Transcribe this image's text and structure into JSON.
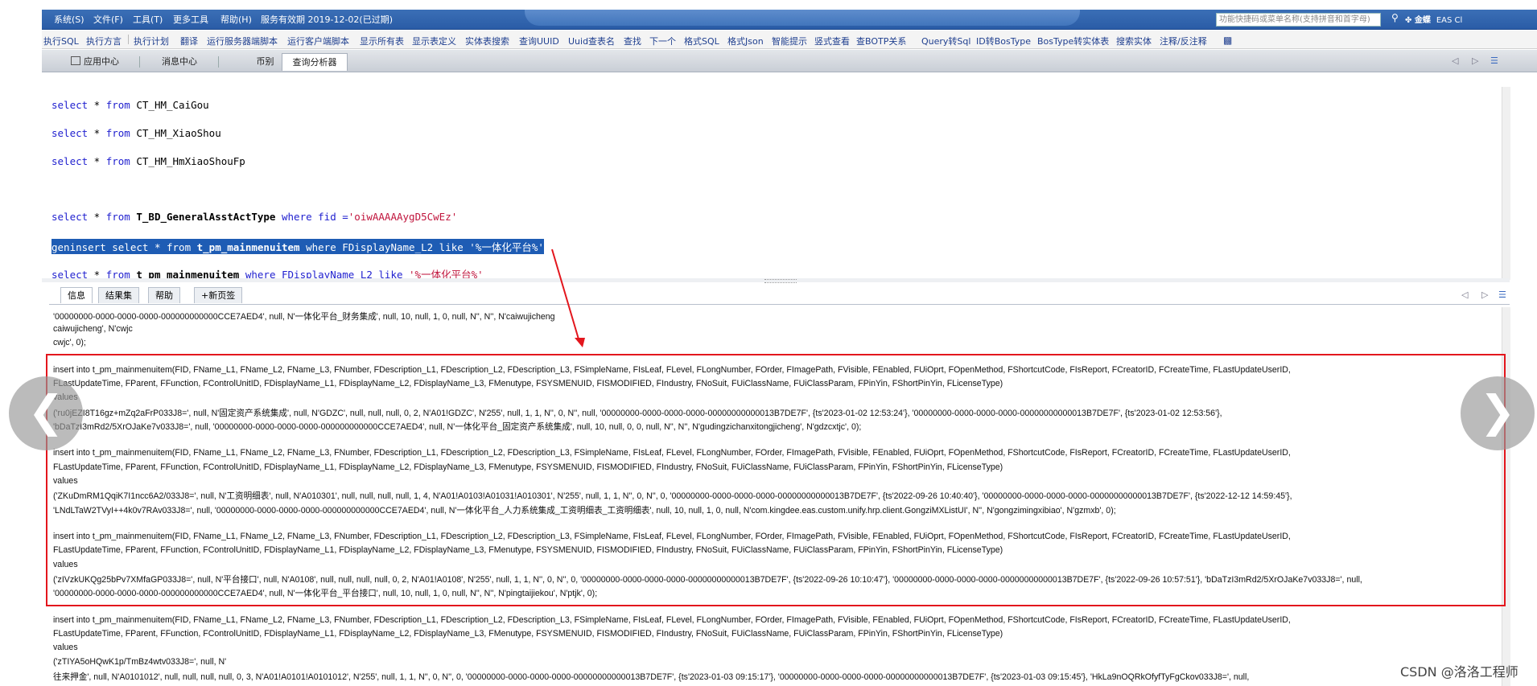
{
  "menubar": {
    "items": [
      "系统(S)",
      "文件(F)",
      "工具(T)",
      "更多工具",
      "帮助(H)",
      "服务有效期 2019-12-02(已过期)"
    ],
    "search_placeholder": "功能快捷码或菜单名称(支持拼音和首字母)",
    "brand": "金蝶",
    "brand_suffix": "EAS Cl"
  },
  "toolbar": {
    "items": [
      "执行SQL",
      "执行方言",
      "执行计划",
      "翻译",
      "运行服务器端脚本",
      "运行客户端脚本",
      "显示所有表",
      "显示表定义",
      "实体表搜索",
      "查询UUID",
      "Uuid查表名",
      "查找",
      "下一个",
      "格式SQL",
      "格式Json",
      "智能提示",
      "竖式查看",
      "查BOTP关系",
      "Query转Sql",
      "ID转BosType",
      "BosType转实体表",
      "搜索实体",
      "注释/反注释"
    ]
  },
  "nav_tabs": [
    "应用中心",
    "消息中心",
    "币别",
    "查询分析器"
  ],
  "editor": {
    "lines": [
      {
        "kw1": "select",
        "mid": " * ",
        "kw2": "from",
        "table": " CT_HM_CaiGou",
        "rest": "",
        "str": "",
        "bold": false,
        "selected": false
      },
      {
        "kw1": "select",
        "mid": " * ",
        "kw2": "from",
        "table": " CT_HM_XiaoShou",
        "rest": "",
        "str": "",
        "bold": false,
        "selected": false
      },
      {
        "kw1": "select",
        "mid": " * ",
        "kw2": "from",
        "table": " CT_HM_HmXiaoShouFp",
        "rest": "",
        "str": "",
        "bold": false,
        "selected": false
      },
      {
        "kw1": "select",
        "mid": " * ",
        "kw2": "from",
        "table": " T_BD_GeneralAsstActType",
        "rest": " where fid =",
        "str": "'oiwAAAAAygD5CwEz'",
        "bold": true,
        "selected": false
      },
      {
        "kw1": "geninsert select",
        "mid": " * ",
        "kw2": "from",
        "table": " t_pm_mainmenuitem",
        "rest": " where FDisplayName_L2 like ",
        "str": "'%一体化平台%'",
        "bold": true,
        "selected": true
      },
      {
        "kw1": "select",
        "mid": " * ",
        "kw2": "from",
        "table": " t_pm_mainmenuitem",
        "rest": " where FDisplayName_L2 like ",
        "str": "'%一体化平台%'",
        "bold": true,
        "selected": false
      }
    ]
  },
  "lower_tabs": [
    "信息",
    "结果集",
    "帮助",
    "+新页签"
  ],
  "output_lines": [
    "'00000000-0000-0000-0000-000000000000CCE7AED4', null, N'一体化平台_财务集成', null, 10, null, 1, 0, null, N'', N'', N'caiwujicheng",
    "caiwujicheng', N'cwjc",
    "cwjc', 0);",
    "",
    "insert into t_pm_mainmenuitem(FID, FName_L1, FName_L2, FName_L3, FNumber, FDescription_L1, FDescription_L2, FDescription_L3, FSimpleName, FIsLeaf, FLevel, FLongNumber, FOrder, FImagePath, FVisible, FEnabled, FUiOprt, FOpenMethod, FShortcutCode, FIsReport, FCreatorID, FCreateTime, FLastUpdateUserID,",
    "FLastUpdateTime, FParent, FFunction, FControlUnitID, FDisplayName_L1, FDisplayName_L2, FDisplayName_L3, FMenutype, FSYSMENUID, FISMODIFIED, FIndustry, FNoSuit, FUiClassName, FUiClassParam, FPinYin, FShortPinYin, FLicenseType)",
    " values",
    "('ru0jEZI8T16gz+mZq2aFrP033J8=', null, N'固定资产系统集成', null, N'GDZC', null, null, null, 0, 2, N'A01!GDZC', N'255', null, 1, 1, N'', 0, N'', null, '00000000-0000-0000-0000-00000000000013B7DE7F', {ts'2023-01-02 12:53:24'}, '00000000-0000-0000-0000-00000000000013B7DE7F', {ts'2023-01-02 12:53:56'},",
    "'bDaTzI3mRd2/5XrOJaKe7v033J8=', null, '00000000-0000-0000-0000-000000000000CCE7AED4', null, N'一体化平台_固定资产系统集成', null, 10, null, 0, 0, null, N'', N'', N'gudingzichanxitongjicheng', N'gdzcxtjc', 0);",
    "",
    "insert into t_pm_mainmenuitem(FID, FName_L1, FName_L2, FName_L3, FNumber, FDescription_L1, FDescription_L2, FDescription_L3, FSimpleName, FIsLeaf, FLevel, FLongNumber, FOrder, FImagePath, FVisible, FEnabled, FUiOprt, FOpenMethod, FShortcutCode, FIsReport, FCreatorID, FCreateTime, FLastUpdateUserID,",
    "FLastUpdateTime, FParent, FFunction, FControlUnitID, FDisplayName_L1, FDisplayName_L2, FDisplayName_L3, FMenutype, FSYSMENUID, FISMODIFIED, FIndustry, FNoSuit, FUiClassName, FUiClassParam, FPinYin, FShortPinYin, FLicenseType)",
    " values",
    "('ZKuDmRM1QqiK7I1ncc6A2/033J8=', null, N'工资明细表', null, N'A010301', null, null, null, null, 1, 4, N'A01!A0103!A01031!A010301', N'255', null, 1, 1, N'', 0, N'', 0, '00000000-0000-0000-0000-00000000000013B7DE7F', {ts'2022-09-26 10:40:40'}, '00000000-0000-0000-0000-00000000000013B7DE7F', {ts'2022-12-12 14:59:45'},",
    "'LNdLTaW2TVyI++4k0v7RAv033J8=', null, '00000000-0000-0000-0000-000000000000CCE7AED4', null, N'一体化平台_人力系统集成_工资明细表_工资明细表', null, 10, null, 1, 0, null, N'com.kingdee.eas.custom.unify.hrp.client.GongziMXListUI', N'', N'gongzimingxibiao', N'gzmxb', 0);",
    "",
    "insert into t_pm_mainmenuitem(FID, FName_L1, FName_L2, FName_L3, FNumber, FDescription_L1, FDescription_L2, FDescription_L3, FSimpleName, FIsLeaf, FLevel, FLongNumber, FOrder, FImagePath, FVisible, FEnabled, FUiOprt, FOpenMethod, FShortcutCode, FIsReport, FCreatorID, FCreateTime, FLastUpdateUserID,",
    "FLastUpdateTime, FParent, FFunction, FControlUnitID, FDisplayName_L1, FDisplayName_L2, FDisplayName_L3, FMenutype, FSYSMENUID, FISMODIFIED, FIndustry, FNoSuit, FUiClassName, FUiClassParam, FPinYin, FShortPinYin, FLicenseType)",
    " values",
    "('zIVzkUKQg25bPv7XMfaGP033J8=', null, N'平台接口', null, N'A0108', null, null, null, null, 0, 2, N'A01!A0108', N'255', null, 1, 1, N'', 0, N'', 0, '00000000-0000-0000-0000-00000000000013B7DE7F', {ts'2022-09-26 10:10:47'}, '00000000-0000-0000-0000-00000000000013B7DE7F', {ts'2022-09-26 10:57:51'}, 'bDaTzI3mRd2/5XrOJaKe7v033J8=', null,",
    "'00000000-0000-0000-0000-000000000000CCE7AED4', null, N'一体化平台_平台接口', null, 10, null, 1, 0, null, N'', N'', N'pingtaijiekou', N'ptjk', 0);",
    "",
    "insert into t_pm_mainmenuitem(FID, FName_L1, FName_L2, FName_L3, FNumber, FDescription_L1, FDescription_L2, FDescription_L3, FSimpleName, FIsLeaf, FLevel, FLongNumber, FOrder, FImagePath, FVisible, FEnabled, FUiOprt, FOpenMethod, FShortcutCode, FIsReport, FCreatorID, FCreateTime, FLastUpdateUserID,",
    "FLastUpdateTime, FParent, FFunction, FControlUnitID, FDisplayName_L1, FDisplayName_L2, FDisplayName_L3, FMenutype, FSYSMENUID, FISMODIFIED, FIndustry, FNoSuit, FUiClassName, FUiClassParam, FPinYin, FShortPinYin, FLicenseType)",
    " values",
    "('zTIYA5oHQwK1p/TmBz4wtv033J8=', null, N'",
    "往来押金', null, N'A0101012', null, null, null, null, 0, 3, N'A01!A0101!A0101012', N'255', null, 1, 1, N'', 0, N'', 0, '00000000-0000-0000-0000-00000000000013B7DE7F', {ts'2023-01-03 09:15:17'}, '00000000-0000-0000-0000-00000000000013B7DE7F', {ts'2023-01-03 09:15:45'}, 'HkLa9nOQRkOfyfTyFgCkov033J8=', null,"
  ],
  "watermark": "CSDN @洛洛工程师",
  "colors": {
    "accent": "#2a5ca6",
    "highlight_box": "#e3161d",
    "selection": "#1e5cb4"
  }
}
